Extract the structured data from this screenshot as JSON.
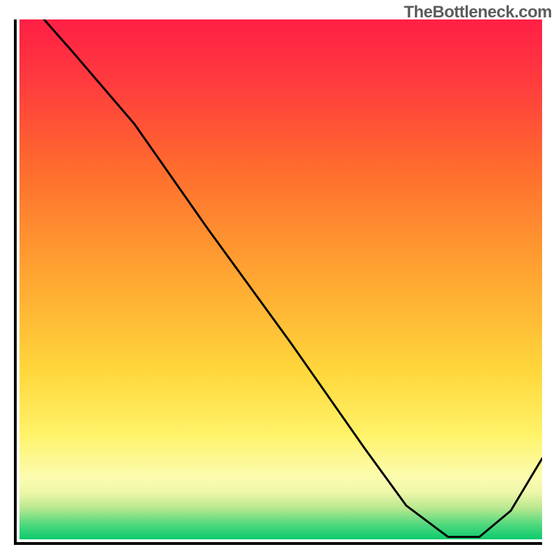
{
  "watermark": "TheBottleneck.com",
  "label_main": "",
  "chart_data": {
    "type": "line",
    "title": "",
    "xlabel": "",
    "ylabel": "",
    "xlim": [
      0,
      100
    ],
    "ylim": [
      0,
      100
    ],
    "x": [
      0,
      10,
      22,
      36,
      52,
      66,
      74,
      82,
      88,
      94,
      100
    ],
    "y": [
      106,
      94,
      80,
      60,
      38,
      18,
      7,
      1,
      1,
      6,
      16
    ],
    "notes": "Curve descends from top-left into a minimum near x≈84 then rises; background is a vertical red→yellow→green gradient representing bottleneck severity."
  }
}
